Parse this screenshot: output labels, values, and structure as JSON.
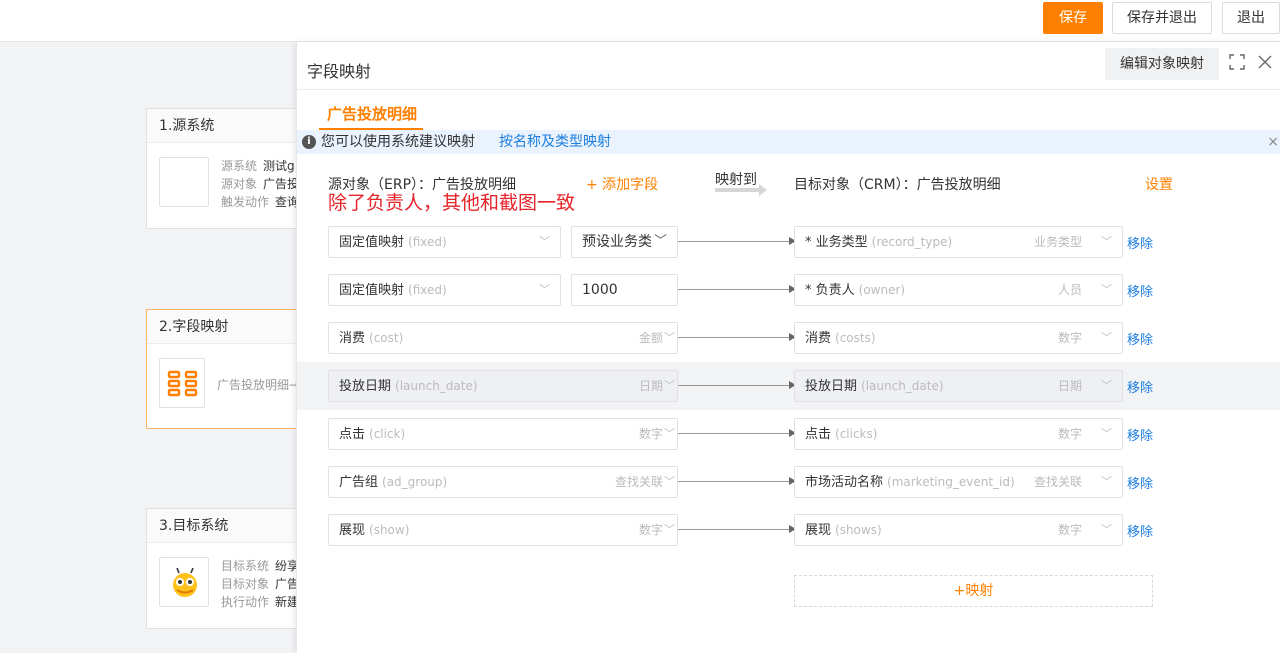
{
  "toolbar": {
    "save_label": "保存",
    "save_exit_label": "保存并退出",
    "exit_label": "退出"
  },
  "steps": [
    {
      "title": "1.源系统",
      "rows": [
        {
          "k": "源系统",
          "v": "测试g"
        },
        {
          "k": "源对象",
          "v": "广告投"
        },
        {
          "k": "触发动作",
          "v": "查询"
        }
      ]
    },
    {
      "title": "2.字段映射",
      "text": "广告投放明细→"
    },
    {
      "title": "3.目标系统",
      "rows": [
        {
          "k": "目标系统",
          "v": "纷享"
        },
        {
          "k": "目标对象",
          "v": "广告"
        },
        {
          "k": "执行动作",
          "v": "新建"
        }
      ]
    }
  ],
  "drawer": {
    "title": "字段映射",
    "edit_btn": "编辑对象映射",
    "tab": "广告投放明细",
    "tip_text": "您可以使用系统建议映射",
    "tip_link": "按名称及类型映射",
    "source_header": "源对象（ERP）：广告投放明细",
    "add_field": "+ 添加字段",
    "map_to": "映射到",
    "target_header": "目标对象（CRM）：广告投放明细",
    "settings": "设置",
    "annotation": "除了负责人，其他和截图一致",
    "add_mapping": "+映射",
    "remove_label": "移除"
  },
  "rows": [
    {
      "src": "固定值映射",
      "src_hint": "(fixed)",
      "src_type": "",
      "mid": "预设业务类",
      "tgt": "* 业务类型",
      "tgt_hint": "(record_type)",
      "tgt_type": "业务类型"
    },
    {
      "src": "固定值映射",
      "src_hint": "(fixed)",
      "src_type": "",
      "mid": "1000",
      "tgt": "* 负责人",
      "tgt_hint": "(owner)",
      "tgt_type": "人员"
    },
    {
      "src": "消费",
      "src_hint": "(cost)",
      "src_type": "金额",
      "mid": "",
      "tgt": "消费",
      "tgt_hint": "(costs)",
      "tgt_type": "数字"
    },
    {
      "src": "投放日期",
      "src_hint": "(launch_date)",
      "src_type": "日期",
      "mid": "",
      "tgt": "投放日期",
      "tgt_hint": "(launch_date)",
      "tgt_type": "日期"
    },
    {
      "src": "点击",
      "src_hint": "(click)",
      "src_type": "数字",
      "mid": "",
      "tgt": "点击",
      "tgt_hint": "(clicks)",
      "tgt_type": "数字"
    },
    {
      "src": "广告组",
      "src_hint": "(ad_group)",
      "src_type": "查找关联",
      "mid": "",
      "tgt": "市场活动名称",
      "tgt_hint": "(marketing_event_id)",
      "tgt_type": "查找关联"
    },
    {
      "src": "展现",
      "src_hint": "(show)",
      "src_type": "数字",
      "mid": "",
      "tgt": "展现",
      "tgt_hint": "(shows)",
      "tgt_type": "数字"
    }
  ],
  "colors": {
    "accent": "#ff8000",
    "link": "#1b7ee0",
    "annotation": "#e6242a",
    "tip_bg": "#e9f2fd"
  }
}
